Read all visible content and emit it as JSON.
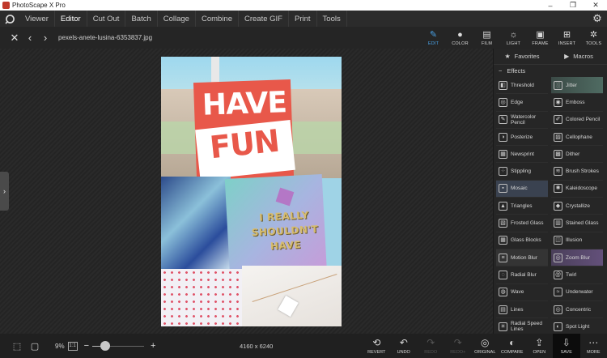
{
  "window": {
    "title": "PhotoScape X Pro",
    "controls": [
      "–",
      "❐",
      "✕"
    ]
  },
  "menu": {
    "items": [
      {
        "label": "Viewer",
        "active": false
      },
      {
        "label": "Editor",
        "active": true
      },
      {
        "label": "Cut Out",
        "active": false
      },
      {
        "label": "Batch",
        "active": false
      },
      {
        "label": "Collage",
        "active": false
      },
      {
        "label": "Combine",
        "active": false
      },
      {
        "label": "Create GIF",
        "active": false
      },
      {
        "label": "Print",
        "active": false
      },
      {
        "label": "Tools",
        "active": false
      }
    ]
  },
  "toolbar": {
    "filename": "pexels-anete-lusina-6353837.jpg",
    "tabs": [
      {
        "label": "EDIT",
        "icon": "edit-icon",
        "active": true
      },
      {
        "label": "COLOR",
        "icon": "color-icon",
        "active": false
      },
      {
        "label": "FILM",
        "icon": "film-icon",
        "active": false
      },
      {
        "label": "LIGHT",
        "icon": "light-icon",
        "active": false
      },
      {
        "label": "FRAME",
        "icon": "frame-icon",
        "active": false
      },
      {
        "label": "INSERT",
        "icon": "insert-icon",
        "active": false
      },
      {
        "label": "TOOLS",
        "icon": "tools-icon",
        "active": false
      }
    ]
  },
  "photo": {
    "line1": "HAVE",
    "line2": "FUN",
    "bag_text": "I REALLY SHOULDN'T HAVE"
  },
  "panel": {
    "favorites_label": "Favorites",
    "macros_label": "Macros",
    "effects_label": "Effects",
    "effects": [
      {
        "label": "Threshold",
        "icon": "threshold-icon"
      },
      {
        "label": "Jitter",
        "icon": "jitter-icon"
      },
      {
        "label": "Edge",
        "icon": "edge-icon"
      },
      {
        "label": "Emboss",
        "icon": "emboss-icon"
      },
      {
        "label": "Watercolor Pencil",
        "icon": "watercolor-pencil-icon"
      },
      {
        "label": "Colored Pencil",
        "icon": "colored-pencil-icon"
      },
      {
        "label": "Posterize",
        "icon": "posterize-icon"
      },
      {
        "label": "Cellophane",
        "icon": "cellophane-icon"
      },
      {
        "label": "Newsprint",
        "icon": "newsprint-icon"
      },
      {
        "label": "Dither",
        "icon": "dither-icon"
      },
      {
        "label": "Stippling",
        "icon": "stippling-icon"
      },
      {
        "label": "Brush Strokes",
        "icon": "brush-strokes-icon"
      },
      {
        "label": "Mosaic",
        "icon": "mosaic-icon"
      },
      {
        "label": "Kaleidoscope",
        "icon": "kaleidoscope-icon"
      },
      {
        "label": "Triangles",
        "icon": "triangles-icon"
      },
      {
        "label": "Crystallize",
        "icon": "crystallize-icon"
      },
      {
        "label": "Frosted Glass",
        "icon": "frosted-glass-icon"
      },
      {
        "label": "Stained Glass",
        "icon": "stained-glass-icon"
      },
      {
        "label": "Glass Blocks",
        "icon": "glass-blocks-icon"
      },
      {
        "label": "Illusion",
        "icon": "illusion-icon"
      },
      {
        "label": "Motion Blur",
        "icon": "motion-blur-icon"
      },
      {
        "label": "Zoom Blur",
        "icon": "zoom-blur-icon"
      },
      {
        "label": "Radial Blur",
        "icon": "radial-blur-icon"
      },
      {
        "label": "Twirl",
        "icon": "twirl-icon"
      },
      {
        "label": "Wave",
        "icon": "wave-icon"
      },
      {
        "label": "Underwater",
        "icon": "underwater-icon"
      },
      {
        "label": "Lines",
        "icon": "lines-icon"
      },
      {
        "label": "Concentric",
        "icon": "concentric-icon"
      },
      {
        "label": "Radial Speed Lines",
        "icon": "radial-speed-lines-icon"
      },
      {
        "label": "Spot Light",
        "icon": "spot-light-icon"
      }
    ]
  },
  "statusbar": {
    "zoom": "9%",
    "fit_label": "1:1",
    "zoom_level": 0.25,
    "dimensions": "4160 x 6240",
    "actions": [
      {
        "label": "REVERT",
        "icon": "revert-icon",
        "enabled": true
      },
      {
        "label": "UNDO",
        "icon": "undo-icon",
        "enabled": true
      },
      {
        "label": "REDO",
        "icon": "redo-icon",
        "enabled": false
      },
      {
        "label": "REDO+",
        "icon": "redo-all-icon",
        "enabled": false
      },
      {
        "label": "ORIGINAL",
        "icon": "original-icon",
        "enabled": true
      },
      {
        "label": "COMPARE",
        "icon": "compare-icon",
        "enabled": true
      },
      {
        "label": "OPEN",
        "icon": "open-icon",
        "enabled": true
      },
      {
        "label": "SAVE",
        "icon": "save-icon",
        "enabled": true
      },
      {
        "label": "MORE",
        "icon": "more-icon",
        "enabled": true
      }
    ]
  },
  "colors": {
    "accent": "#4aa3e8",
    "background": "#1e1e1e",
    "panel": "#262626"
  }
}
